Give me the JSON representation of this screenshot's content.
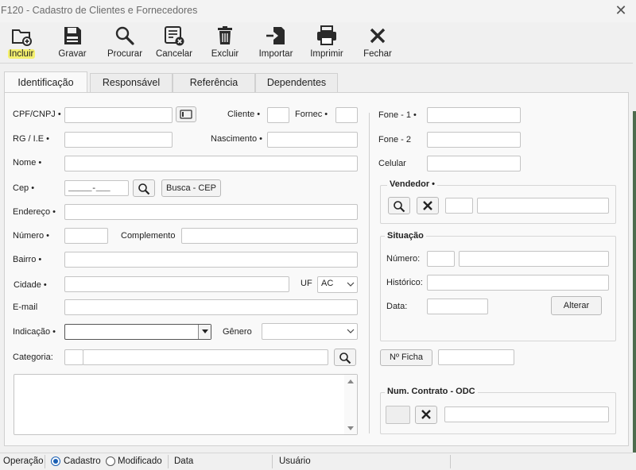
{
  "window": {
    "title": "F120 - Cadastro de Clientes e Fornecedores",
    "close_glyph": "✕"
  },
  "toolbar": {
    "incluir": "Incluir",
    "gravar": "Gravar",
    "procurar": "Procurar",
    "cancelar": "Cancelar",
    "excluir": "Excluir",
    "importar": "Importar",
    "imprimir": "Imprimir",
    "fechar": "Fechar"
  },
  "tabs": {
    "identificacao": "Identificação",
    "responsavel": "Responsável",
    "referencia": "Referência",
    "dependentes": "Dependentes"
  },
  "form": {
    "cpf_label": "CPF/CNPJ •",
    "cliente_label": "Cliente •",
    "fornec_label": "Fornec •",
    "rg_label": "RG / I.E •",
    "nascimento_label": "Nascimento •",
    "nome_label": "Nome •",
    "cep_label": "Cep •",
    "cep_mask": "_____-___",
    "busca_cep": "Busca - CEP",
    "endereco_label": "Endereço •",
    "numero_label": "Número •",
    "complemento_label": "Complemento",
    "bairro_label": "Bairro •",
    "cidade_label": "Cidade •",
    "uf_label": "UF",
    "uf_value": "AC",
    "email_label": "E-mail",
    "indicacao_label": "Indicação •",
    "genero_label": "Gênero",
    "categoria_label": "Categoria:"
  },
  "right": {
    "fone1_label": "Fone - 1 •",
    "fone2_label": "Fone - 2",
    "celular_label": "Celular",
    "vendedor_title": "Vendedor •",
    "situacao_title": "Situação",
    "numero_label": "Número:",
    "historico_label": "Histórico:",
    "data_label": "Data:",
    "alterar": "Alterar",
    "ficha_btn": "Nº Ficha",
    "contrato_title": "Num. Contrato - ODC"
  },
  "status": {
    "operacao": "Operação",
    "cadastro": "Cadastro",
    "modificado": "Modificado",
    "data": "Data",
    "usuario": "Usuário",
    "selected": "Cadastro"
  }
}
